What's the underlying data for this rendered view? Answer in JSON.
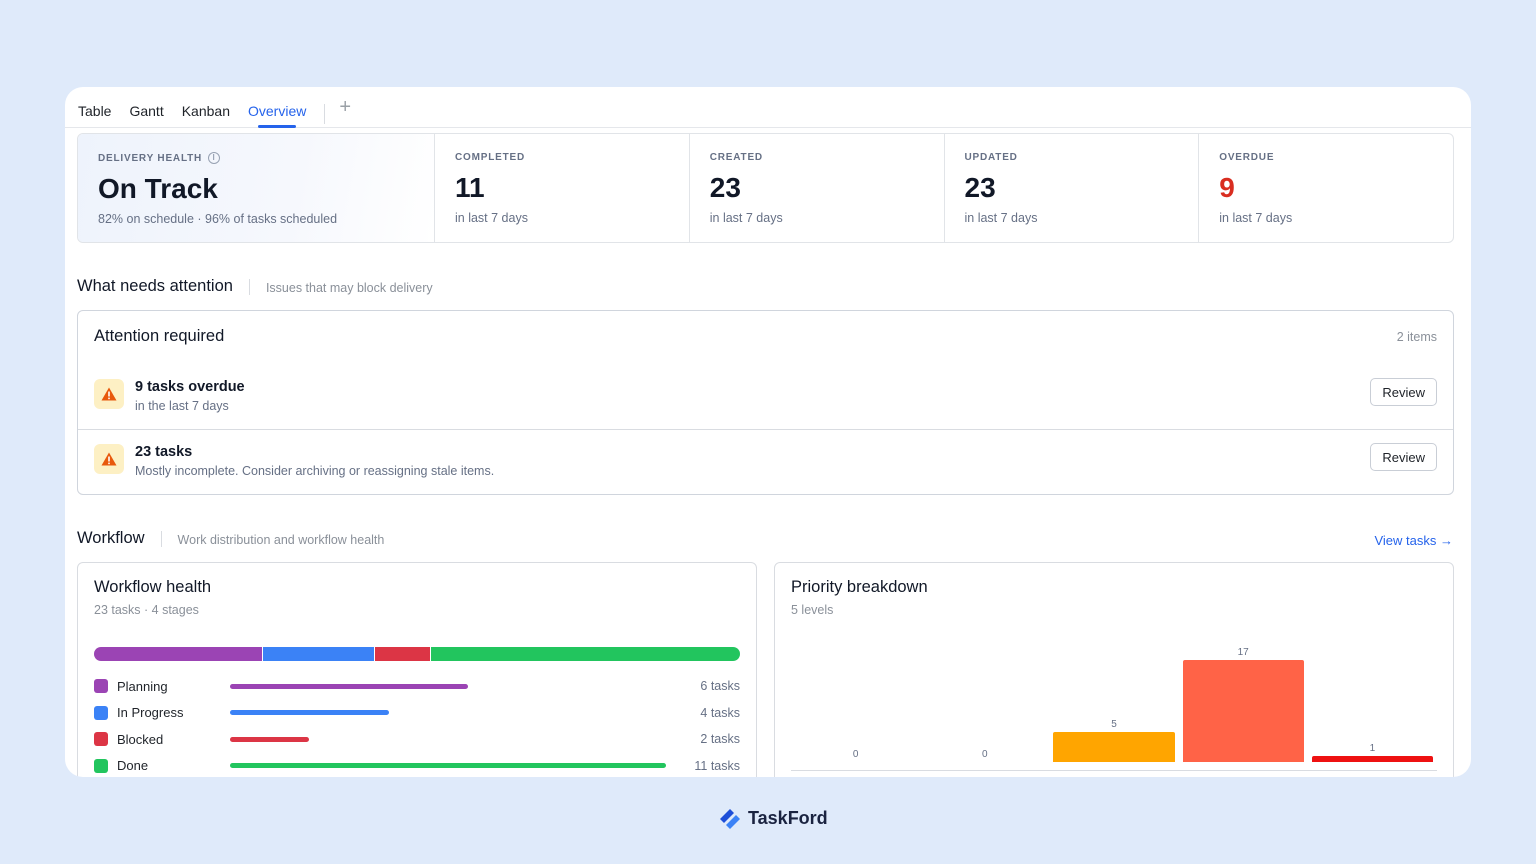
{
  "tabs": [
    {
      "label": "Table",
      "active": false
    },
    {
      "label": "Gantt",
      "active": false
    },
    {
      "label": "Kanban",
      "active": false
    },
    {
      "label": "Overview",
      "active": true
    }
  ],
  "tab_add_label": "+",
  "stats": {
    "delivery": {
      "label": "DELIVERY HEALTH",
      "value": "On Track",
      "sub": "82% on schedule · 96% of tasks scheduled"
    },
    "completed": {
      "label": "COMPLETED",
      "value": "11",
      "sub": "in last 7 days"
    },
    "created": {
      "label": "CREATED",
      "value": "23",
      "sub": "in last 7 days"
    },
    "updated": {
      "label": "UPDATED",
      "value": "23",
      "sub": "in last 7 days"
    },
    "overdue": {
      "label": "OVERDUE",
      "value": "9",
      "sub": "in last 7 days",
      "color": "#d92d20"
    }
  },
  "attention_section": {
    "title": "What needs attention",
    "desc": "Issues that may block delivery"
  },
  "attention": {
    "title": "Attention required",
    "count": "2 items",
    "items": [
      {
        "title": "9 tasks overdue",
        "sub": "in the last 7 days",
        "button": "Review"
      },
      {
        "title": "23 tasks",
        "sub": "Mostly incomplete. Consider archiving or reassigning stale items.",
        "button": "Review"
      }
    ]
  },
  "workflow_section": {
    "title": "Workflow",
    "desc": "Work distribution and workflow health",
    "link": "View tasks →"
  },
  "workflow_health": {
    "title": "Workflow health",
    "sub": "23 tasks · 4 stages",
    "stages": [
      {
        "name": "Planning",
        "count": 6,
        "count_label": "6 tasks",
        "color": "#9b44b4"
      },
      {
        "name": "In Progress",
        "count": 4,
        "count_label": "4 tasks",
        "color": "#3b82f6"
      },
      {
        "name": "Blocked",
        "count": 2,
        "count_label": "2 tasks",
        "color": "#dc3545"
      },
      {
        "name": "Done",
        "count": 11,
        "count_label": "11 tasks",
        "color": "#22c55e"
      }
    ]
  },
  "priority": {
    "title": "Priority breakdown",
    "sub": "5 levels"
  },
  "chart_data": {
    "type": "bar",
    "title": "Priority breakdown",
    "values": [
      0,
      0,
      5,
      17,
      1
    ],
    "colors": [
      "#cbd5e1",
      "#cbd5e1",
      "#ffa500",
      "#ff6347",
      "#ee1111"
    ],
    "ylim": [
      0,
      17
    ]
  },
  "brand": {
    "name": "TaskFord",
    "color": "#2563eb"
  }
}
